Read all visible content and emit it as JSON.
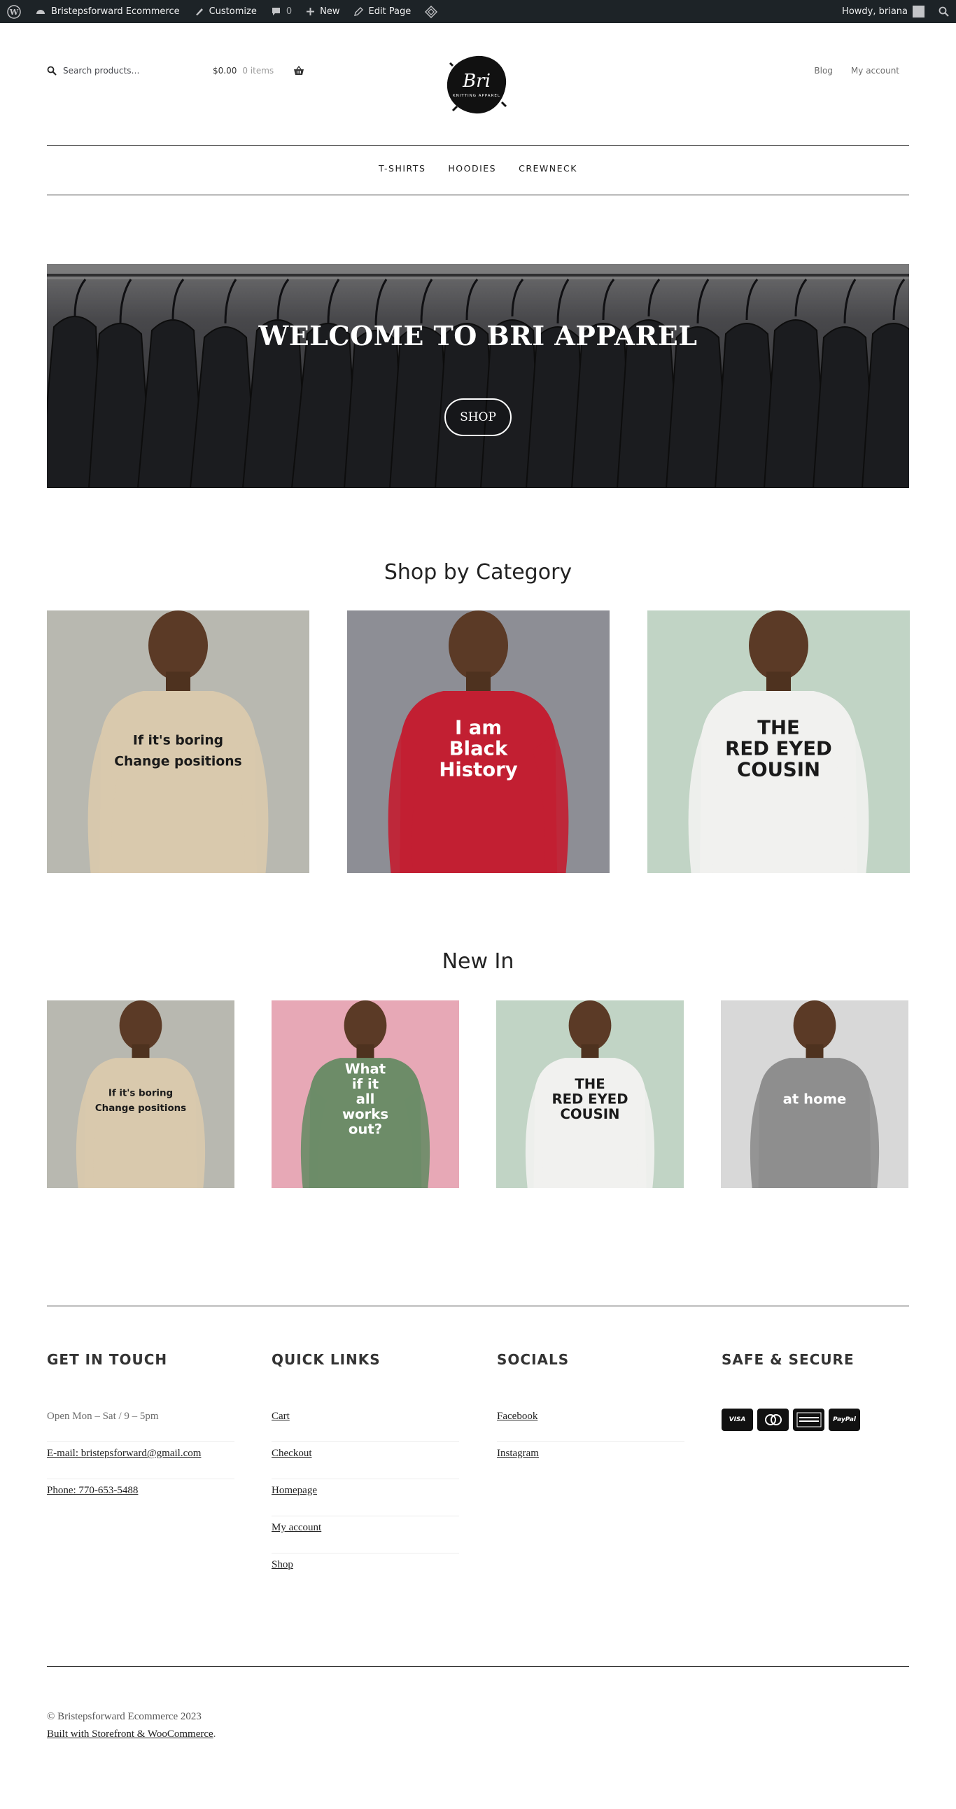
{
  "admin_bar": {
    "site_name": "Bristepsforward Ecommerce",
    "customize": "Customize",
    "comments_count": "0",
    "new": "New",
    "edit_page": "Edit Page",
    "howdy": "Howdy, briana"
  },
  "header": {
    "search_placeholder": "Search products…",
    "cart_total": "$0.00",
    "cart_items": "0 items",
    "logo_text": "Bri",
    "logo_subtext": "KNITTING APPAREL",
    "links": [
      "Blog",
      "My account"
    ]
  },
  "nav": [
    "T-SHIRTS",
    "HOODIES",
    "CREWNECK"
  ],
  "hero": {
    "title": "WELCOME TO BRI APPAREL",
    "button": "SHOP"
  },
  "categories": {
    "title": "Shop by Category",
    "items": [
      {
        "print": [
          "If it's boring",
          "Change positions"
        ],
        "shirt_color": "#d9c9ad",
        "bg": "#b8b8b0"
      },
      {
        "print": [
          "I am",
          "Black",
          "History"
        ],
        "shirt_color": "#c21f32",
        "bg": "#8d8e95"
      },
      {
        "print": [
          "THE",
          "RED EYED",
          "COUSIN"
        ],
        "shirt_color": "#f1f1ef",
        "bg": "#c1d4c5"
      }
    ]
  },
  "new_in": {
    "title": "New In",
    "items": [
      {
        "print": [
          "If it's boring",
          "Change positions"
        ],
        "shirt_color": "#d9c9ad",
        "bg": "#b8b8b0"
      },
      {
        "print": [
          "What",
          "if it",
          "all",
          "works",
          "out?"
        ],
        "shirt_color": "#6d8c68",
        "bg": "#e7a8b6"
      },
      {
        "print": [
          "THE",
          "RED EYED",
          "COUSIN"
        ],
        "shirt_color": "#f1f1ef",
        "bg": "#c1d4c5"
      },
      {
        "print": [
          "at home"
        ],
        "shirt_color": "#8e8e8e",
        "bg": "#d8d8d8"
      }
    ]
  },
  "footer": {
    "get_in_touch": {
      "title": "GET IN TOUCH",
      "hours": "Open Mon – Sat / 9 – 5pm",
      "email": "E-mail: bristepsforward@gmail.com",
      "phone": "Phone: 770-653-5488"
    },
    "quick_links": {
      "title": "QUICK LINKS",
      "items": [
        "Cart",
        "Checkout",
        "Homepage",
        "My account",
        "Shop"
      ]
    },
    "socials": {
      "title": "SOCIALS",
      "items": [
        "Facebook",
        "Instagram"
      ]
    },
    "safe": {
      "title": "SAFE & SECURE",
      "cards": [
        "VISA",
        "MC",
        "AMEX",
        "PayPal"
      ]
    },
    "copyright": "© Bristepsforward Ecommerce 2023",
    "built_with": "Built with Storefront & WooCommerce"
  }
}
